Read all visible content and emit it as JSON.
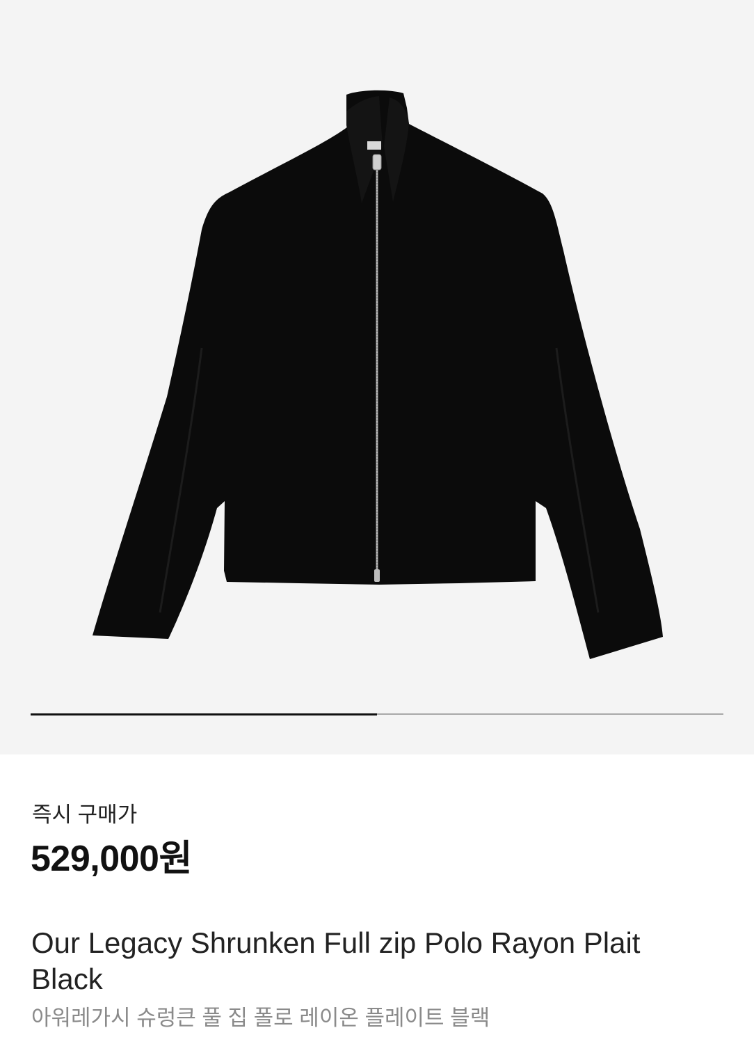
{
  "product": {
    "image_alt": "product-image",
    "price_label": "즉시 구매가",
    "price": "529,000원",
    "name_en": "Our Legacy Shrunken Full zip Polo Rayon Plait Black",
    "name_ko": "아워레가시 슈렁큰 풀 집 폴로 레이온 플레이트 블랙"
  },
  "gallery": {
    "progress": 0.5,
    "background_color": "#f4f4f4",
    "indicator_color": "#111111",
    "track_color": "#a8a8a8"
  }
}
